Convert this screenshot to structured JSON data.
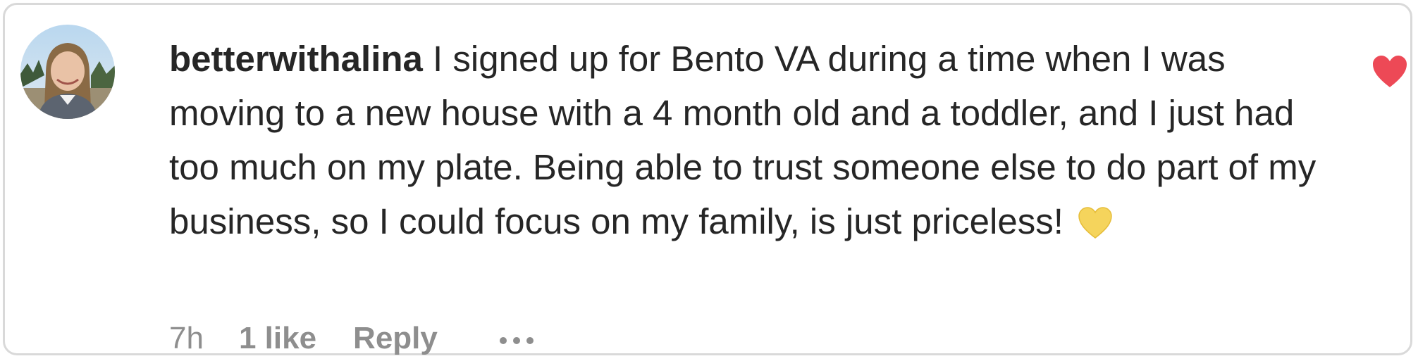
{
  "comment": {
    "username": "betterwithalina",
    "text": " I signed up for Bento VA during a time when I was moving to a new house with a 4 month old and a toddler, and I just had too much on my plate. Being able to trust someone else to do part of my business, so I could focus on my family, is just priceless!",
    "emoji_icon": "yellow-heart-icon"
  },
  "meta": {
    "time": "7h",
    "likes": "1 like",
    "reply": "Reply",
    "more_icon": "more-options-icon"
  },
  "like_icon": "heart-filled-icon",
  "colors": {
    "like_heart": "#ed4956",
    "text": "#262626",
    "meta": "#8e8e8e",
    "emoji_heart": "#f5d45c"
  }
}
